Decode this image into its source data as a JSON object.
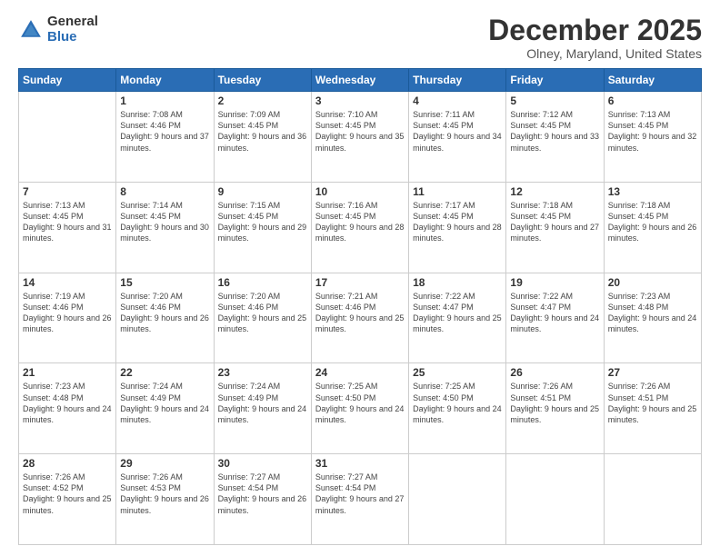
{
  "logo": {
    "general": "General",
    "blue": "Blue"
  },
  "title": "December 2025",
  "location": "Olney, Maryland, United States",
  "days_header": [
    "Sunday",
    "Monday",
    "Tuesday",
    "Wednesday",
    "Thursday",
    "Friday",
    "Saturday"
  ],
  "weeks": [
    [
      {
        "num": "",
        "sunrise": "",
        "sunset": "",
        "daylight": ""
      },
      {
        "num": "1",
        "sunrise": "Sunrise: 7:08 AM",
        "sunset": "Sunset: 4:46 PM",
        "daylight": "Daylight: 9 hours and 37 minutes."
      },
      {
        "num": "2",
        "sunrise": "Sunrise: 7:09 AM",
        "sunset": "Sunset: 4:45 PM",
        "daylight": "Daylight: 9 hours and 36 minutes."
      },
      {
        "num": "3",
        "sunrise": "Sunrise: 7:10 AM",
        "sunset": "Sunset: 4:45 PM",
        "daylight": "Daylight: 9 hours and 35 minutes."
      },
      {
        "num": "4",
        "sunrise": "Sunrise: 7:11 AM",
        "sunset": "Sunset: 4:45 PM",
        "daylight": "Daylight: 9 hours and 34 minutes."
      },
      {
        "num": "5",
        "sunrise": "Sunrise: 7:12 AM",
        "sunset": "Sunset: 4:45 PM",
        "daylight": "Daylight: 9 hours and 33 minutes."
      },
      {
        "num": "6",
        "sunrise": "Sunrise: 7:13 AM",
        "sunset": "Sunset: 4:45 PM",
        "daylight": "Daylight: 9 hours and 32 minutes."
      }
    ],
    [
      {
        "num": "7",
        "sunrise": "Sunrise: 7:13 AM",
        "sunset": "Sunset: 4:45 PM",
        "daylight": "Daylight: 9 hours and 31 minutes."
      },
      {
        "num": "8",
        "sunrise": "Sunrise: 7:14 AM",
        "sunset": "Sunset: 4:45 PM",
        "daylight": "Daylight: 9 hours and 30 minutes."
      },
      {
        "num": "9",
        "sunrise": "Sunrise: 7:15 AM",
        "sunset": "Sunset: 4:45 PM",
        "daylight": "Daylight: 9 hours and 29 minutes."
      },
      {
        "num": "10",
        "sunrise": "Sunrise: 7:16 AM",
        "sunset": "Sunset: 4:45 PM",
        "daylight": "Daylight: 9 hours and 28 minutes."
      },
      {
        "num": "11",
        "sunrise": "Sunrise: 7:17 AM",
        "sunset": "Sunset: 4:45 PM",
        "daylight": "Daylight: 9 hours and 28 minutes."
      },
      {
        "num": "12",
        "sunrise": "Sunrise: 7:18 AM",
        "sunset": "Sunset: 4:45 PM",
        "daylight": "Daylight: 9 hours and 27 minutes."
      },
      {
        "num": "13",
        "sunrise": "Sunrise: 7:18 AM",
        "sunset": "Sunset: 4:45 PM",
        "daylight": "Daylight: 9 hours and 26 minutes."
      }
    ],
    [
      {
        "num": "14",
        "sunrise": "Sunrise: 7:19 AM",
        "sunset": "Sunset: 4:46 PM",
        "daylight": "Daylight: 9 hours and 26 minutes."
      },
      {
        "num": "15",
        "sunrise": "Sunrise: 7:20 AM",
        "sunset": "Sunset: 4:46 PM",
        "daylight": "Daylight: 9 hours and 26 minutes."
      },
      {
        "num": "16",
        "sunrise": "Sunrise: 7:20 AM",
        "sunset": "Sunset: 4:46 PM",
        "daylight": "Daylight: 9 hours and 25 minutes."
      },
      {
        "num": "17",
        "sunrise": "Sunrise: 7:21 AM",
        "sunset": "Sunset: 4:46 PM",
        "daylight": "Daylight: 9 hours and 25 minutes."
      },
      {
        "num": "18",
        "sunrise": "Sunrise: 7:22 AM",
        "sunset": "Sunset: 4:47 PM",
        "daylight": "Daylight: 9 hours and 25 minutes."
      },
      {
        "num": "19",
        "sunrise": "Sunrise: 7:22 AM",
        "sunset": "Sunset: 4:47 PM",
        "daylight": "Daylight: 9 hours and 24 minutes."
      },
      {
        "num": "20",
        "sunrise": "Sunrise: 7:23 AM",
        "sunset": "Sunset: 4:48 PM",
        "daylight": "Daylight: 9 hours and 24 minutes."
      }
    ],
    [
      {
        "num": "21",
        "sunrise": "Sunrise: 7:23 AM",
        "sunset": "Sunset: 4:48 PM",
        "daylight": "Daylight: 9 hours and 24 minutes."
      },
      {
        "num": "22",
        "sunrise": "Sunrise: 7:24 AM",
        "sunset": "Sunset: 4:49 PM",
        "daylight": "Daylight: 9 hours and 24 minutes."
      },
      {
        "num": "23",
        "sunrise": "Sunrise: 7:24 AM",
        "sunset": "Sunset: 4:49 PM",
        "daylight": "Daylight: 9 hours and 24 minutes."
      },
      {
        "num": "24",
        "sunrise": "Sunrise: 7:25 AM",
        "sunset": "Sunset: 4:50 PM",
        "daylight": "Daylight: 9 hours and 24 minutes."
      },
      {
        "num": "25",
        "sunrise": "Sunrise: 7:25 AM",
        "sunset": "Sunset: 4:50 PM",
        "daylight": "Daylight: 9 hours and 24 minutes."
      },
      {
        "num": "26",
        "sunrise": "Sunrise: 7:26 AM",
        "sunset": "Sunset: 4:51 PM",
        "daylight": "Daylight: 9 hours and 25 minutes."
      },
      {
        "num": "27",
        "sunrise": "Sunrise: 7:26 AM",
        "sunset": "Sunset: 4:51 PM",
        "daylight": "Daylight: 9 hours and 25 minutes."
      }
    ],
    [
      {
        "num": "28",
        "sunrise": "Sunrise: 7:26 AM",
        "sunset": "Sunset: 4:52 PM",
        "daylight": "Daylight: 9 hours and 25 minutes."
      },
      {
        "num": "29",
        "sunrise": "Sunrise: 7:26 AM",
        "sunset": "Sunset: 4:53 PM",
        "daylight": "Daylight: 9 hours and 26 minutes."
      },
      {
        "num": "30",
        "sunrise": "Sunrise: 7:27 AM",
        "sunset": "Sunset: 4:54 PM",
        "daylight": "Daylight: 9 hours and 26 minutes."
      },
      {
        "num": "31",
        "sunrise": "Sunrise: 7:27 AM",
        "sunset": "Sunset: 4:54 PM",
        "daylight": "Daylight: 9 hours and 27 minutes."
      },
      {
        "num": "",
        "sunrise": "",
        "sunset": "",
        "daylight": ""
      },
      {
        "num": "",
        "sunrise": "",
        "sunset": "",
        "daylight": ""
      },
      {
        "num": "",
        "sunrise": "",
        "sunset": "",
        "daylight": ""
      }
    ]
  ]
}
